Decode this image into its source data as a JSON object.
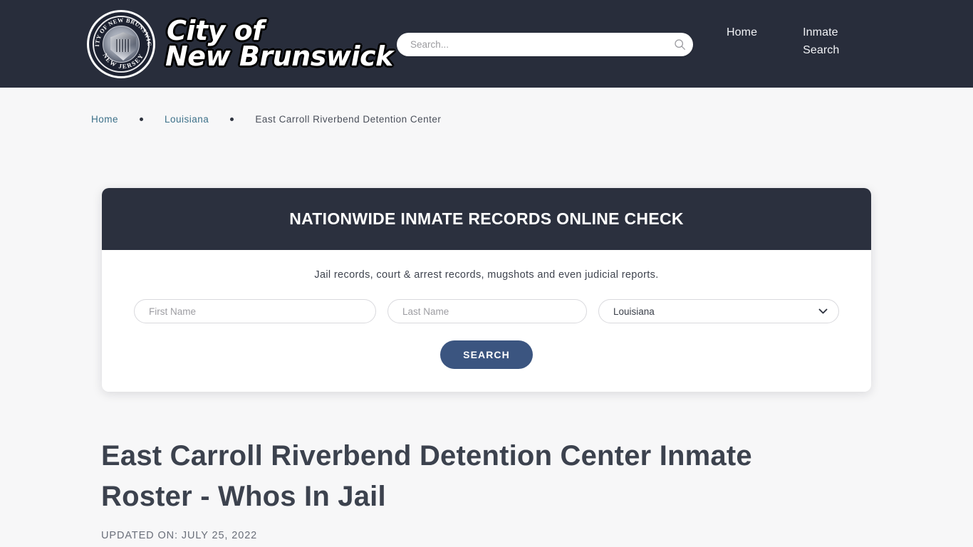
{
  "header": {
    "brand": {
      "line1": "City of",
      "line2": "New Brunswick",
      "seal_top_text": "CITY OF NEW BRUNSWICK",
      "seal_bottom_text": "NEW JERSEY"
    },
    "search": {
      "placeholder": "Search...",
      "value": "",
      "icon": "search-icon"
    },
    "nav": [
      {
        "label": "Home"
      },
      {
        "label": "Inmate\nSearch"
      }
    ],
    "background_color": "#282d3b"
  },
  "breadcrumb": {
    "items": [
      {
        "label": "Home",
        "type": "link"
      },
      {
        "label": "Louisiana",
        "type": "link"
      },
      {
        "label": "East Carroll Riverbend Detention Center",
        "type": "current"
      }
    ],
    "separator": "•",
    "link_color": "#3c7089"
  },
  "search_card": {
    "title": "NATIONWIDE INMATE RECORDS ONLINE CHECK",
    "subtitle": "Jail records, court & arrest records, mugshots and even judicial reports.",
    "header_color": "#2b303e",
    "first_name": {
      "placeholder": "First Name",
      "value": ""
    },
    "last_name": {
      "placeholder": "Last Name",
      "value": ""
    },
    "state": {
      "selected": "Louisiana",
      "options": [
        "Louisiana"
      ],
      "icon": "chevron-down-icon"
    },
    "submit_label": "SEARCH",
    "submit_color": "#3b5580"
  },
  "article": {
    "title": "East Carroll Riverbend Detention Center Inmate Roster - Whos In Jail",
    "updated": "UPDATED ON: JULY 25, 2022"
  }
}
